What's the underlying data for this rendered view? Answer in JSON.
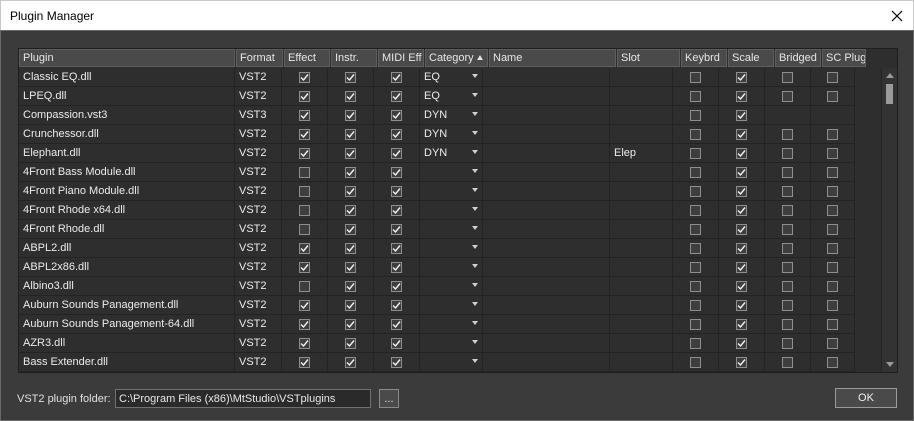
{
  "window": {
    "title": "Plugin Manager"
  },
  "columns": [
    {
      "key": "plugin",
      "label": "Plugin",
      "w": 216
    },
    {
      "key": "format",
      "label": "Format",
      "w": 47
    },
    {
      "key": "effect",
      "label": "Effect",
      "w": 46
    },
    {
      "key": "instr",
      "label": "Instr.",
      "w": 46
    },
    {
      "key": "midi",
      "label": "MIDI Eff",
      "w": 46
    },
    {
      "key": "category",
      "label": "Category",
      "w": 63
    },
    {
      "key": "name",
      "label": "Name",
      "w": 127
    },
    {
      "key": "slot",
      "label": "Slot",
      "w": 63
    },
    {
      "key": "keybrd",
      "label": "Keybrd",
      "w": 46
    },
    {
      "key": "scale",
      "label": "Scale",
      "w": 46
    },
    {
      "key": "bridged",
      "label": "Bridged",
      "w": 46
    },
    {
      "key": "scplug",
      "label": "SC Plug",
      "w": 44
    }
  ],
  "rows": [
    {
      "plugin": "Classic EQ.dll",
      "format": "VST2",
      "effect": true,
      "instr": true,
      "midi": true,
      "category": "EQ",
      "name": "",
      "slot": "",
      "keybrd": false,
      "scale": true,
      "bridged": false,
      "scplug": false
    },
    {
      "plugin": "LPEQ.dll",
      "format": "VST2",
      "effect": true,
      "instr": true,
      "midi": true,
      "category": "EQ",
      "name": "",
      "slot": "",
      "keybrd": false,
      "scale": true,
      "bridged": false,
      "scplug": false
    },
    {
      "plugin": "Compassion.vst3",
      "format": "VST3",
      "effect": true,
      "instr": true,
      "midi": true,
      "category": "DYN",
      "name": "",
      "slot": "",
      "keybrd": false,
      "scale": true,
      "bridged": null,
      "scplug": null
    },
    {
      "plugin": "Crunchessor.dll",
      "format": "VST2",
      "effect": true,
      "instr": true,
      "midi": true,
      "category": "DYN",
      "name": "",
      "slot": "",
      "keybrd": false,
      "scale": true,
      "bridged": false,
      "scplug": false
    },
    {
      "plugin": "Elephant.dll",
      "format": "VST2",
      "effect": true,
      "instr": true,
      "midi": true,
      "category": "DYN",
      "name": "",
      "slot": "Elep",
      "keybrd": false,
      "scale": true,
      "bridged": false,
      "scplug": false
    },
    {
      "plugin": "4Front Bass Module.dll",
      "format": "VST2",
      "effect": false,
      "instr": true,
      "midi": true,
      "category": "",
      "name": "",
      "slot": "",
      "keybrd": false,
      "scale": true,
      "bridged": false,
      "scplug": false
    },
    {
      "plugin": "4Front Piano Module.dll",
      "format": "VST2",
      "effect": false,
      "instr": true,
      "midi": true,
      "category": "",
      "name": "",
      "slot": "",
      "keybrd": false,
      "scale": true,
      "bridged": false,
      "scplug": false
    },
    {
      "plugin": "4Front Rhode x64.dll",
      "format": "VST2",
      "effect": false,
      "instr": true,
      "midi": true,
      "category": "",
      "name": "",
      "slot": "",
      "keybrd": false,
      "scale": true,
      "bridged": false,
      "scplug": false
    },
    {
      "plugin": "4Front Rhode.dll",
      "format": "VST2",
      "effect": false,
      "instr": true,
      "midi": true,
      "category": "",
      "name": "",
      "slot": "",
      "keybrd": false,
      "scale": true,
      "bridged": false,
      "scplug": false
    },
    {
      "plugin": "ABPL2.dll",
      "format": "VST2",
      "effect": true,
      "instr": true,
      "midi": true,
      "category": "",
      "name": "",
      "slot": "",
      "keybrd": false,
      "scale": true,
      "bridged": false,
      "scplug": false
    },
    {
      "plugin": "ABPL2x86.dll",
      "format": "VST2",
      "effect": true,
      "instr": true,
      "midi": true,
      "category": "",
      "name": "",
      "slot": "",
      "keybrd": false,
      "scale": true,
      "bridged": false,
      "scplug": false
    },
    {
      "plugin": "Albino3.dll",
      "format": "VST2",
      "effect": false,
      "instr": true,
      "midi": true,
      "category": "",
      "name": "",
      "slot": "",
      "keybrd": false,
      "scale": true,
      "bridged": false,
      "scplug": false
    },
    {
      "plugin": "Auburn Sounds Panagement.dll",
      "format": "VST2",
      "effect": true,
      "instr": true,
      "midi": true,
      "category": "",
      "name": "",
      "slot": "",
      "keybrd": false,
      "scale": true,
      "bridged": false,
      "scplug": false
    },
    {
      "plugin": "Auburn Sounds Panagement-64.dll",
      "format": "VST2",
      "effect": true,
      "instr": true,
      "midi": true,
      "category": "",
      "name": "",
      "slot": "",
      "keybrd": false,
      "scale": true,
      "bridged": false,
      "scplug": false
    },
    {
      "plugin": "AZR3.dll",
      "format": "VST2",
      "effect": true,
      "instr": true,
      "midi": true,
      "category": "",
      "name": "",
      "slot": "",
      "keybrd": false,
      "scale": true,
      "bridged": false,
      "scplug": false
    },
    {
      "plugin": "Bass Extender.dll",
      "format": "VST2",
      "effect": true,
      "instr": true,
      "midi": true,
      "category": "",
      "name": "",
      "slot": "",
      "keybrd": false,
      "scale": true,
      "bridged": false,
      "scplug": false
    }
  ],
  "footer": {
    "folder_label": "VST2 plugin folder:",
    "folder_value": "C:\\Program Files (x86)\\MtStudio\\VSTplugins",
    "browse_label": "...",
    "ok_label": "OK"
  }
}
